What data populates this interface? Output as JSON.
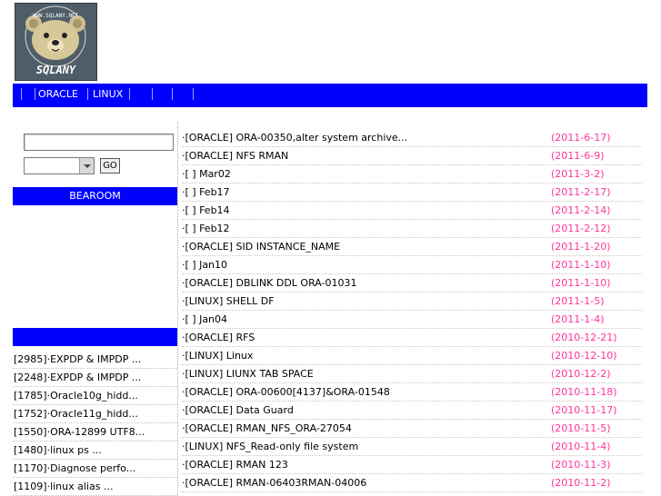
{
  "logo": {
    "text": "SQLANY",
    "ring_text": "WWW.SQLANY.NET"
  },
  "nav": {
    "items": [
      "ORACLE",
      "LINUX"
    ]
  },
  "sidebar": {
    "go_label": "GO",
    "header1": "BEAROOM",
    "header2": "",
    "top_items": [
      "[2985]·EXPDP & IMPDP ...",
      "[2248]·EXPDP & IMPDP ...",
      "[1785]·Oracle10g_hidd...",
      "[1752]·Oracle11g_hidd...",
      "[1550]·ORA-12899 UTF8...",
      "[1480]·linux ps    ...",
      "[1170]·Diagnose perfo...",
      "[1109]·linux alias  ..."
    ]
  },
  "articles": [
    {
      "title": "·[ORACLE] ORA-00350,alter system archive...",
      "date": "(2011-6-17)"
    },
    {
      "title": "·[ORACLE]   NFS    RMAN",
      "date": "(2011-6-9)"
    },
    {
      "title": "·[  ]    Mar02",
      "date": "(2011-3-2)"
    },
    {
      "title": "·[  ]    Feb17",
      "date": "(2011-2-17)"
    },
    {
      "title": "·[  ]    Feb14",
      "date": "(2011-2-14)"
    },
    {
      "title": "·[  ]    Feb12",
      "date": "(2011-2-12)"
    },
    {
      "title": "·[ORACLE] SID INSTANCE_NAME",
      "date": "(2011-1-20)"
    },
    {
      "title": "·[  ]    Jan10",
      "date": "(2011-1-10)"
    },
    {
      "title": "·[ORACLE]   DBLINK    DDL ORA-01031",
      "date": "(2011-1-10)"
    },
    {
      "title": "·[LINUX]   SHELL    DF",
      "date": "(2011-1-5)"
    },
    {
      "title": "·[  ]    Jan04",
      "date": "(2011-1-4)"
    },
    {
      "title": "·[ORACLE] RFS",
      "date": "(2010-12-21)"
    },
    {
      "title": "·[LINUX] Linux",
      "date": "(2010-12-10)"
    },
    {
      "title": "·[LINUX] LIUNX   TAB SPACE",
      "date": "(2010-12-2)"
    },
    {
      "title": "·[ORACLE] ORA-00600[4137]&ORA-01548",
      "date": "(2010-11-18)"
    },
    {
      "title": "·[ORACLE] Data Guard",
      "date": "(2010-11-17)"
    },
    {
      "title": "·[ORACLE] RMAN_NFS_ORA-27054",
      "date": "(2010-11-5)"
    },
    {
      "title": "·[LINUX] NFS_Read-only file system",
      "date": "(2010-11-4)"
    },
    {
      "title": "·[ORACLE] RMAN   123",
      "date": "(2010-11-3)"
    },
    {
      "title": "·[ORACLE] RMAN-06403RMAN-04006",
      "date": "(2010-11-2)"
    }
  ]
}
